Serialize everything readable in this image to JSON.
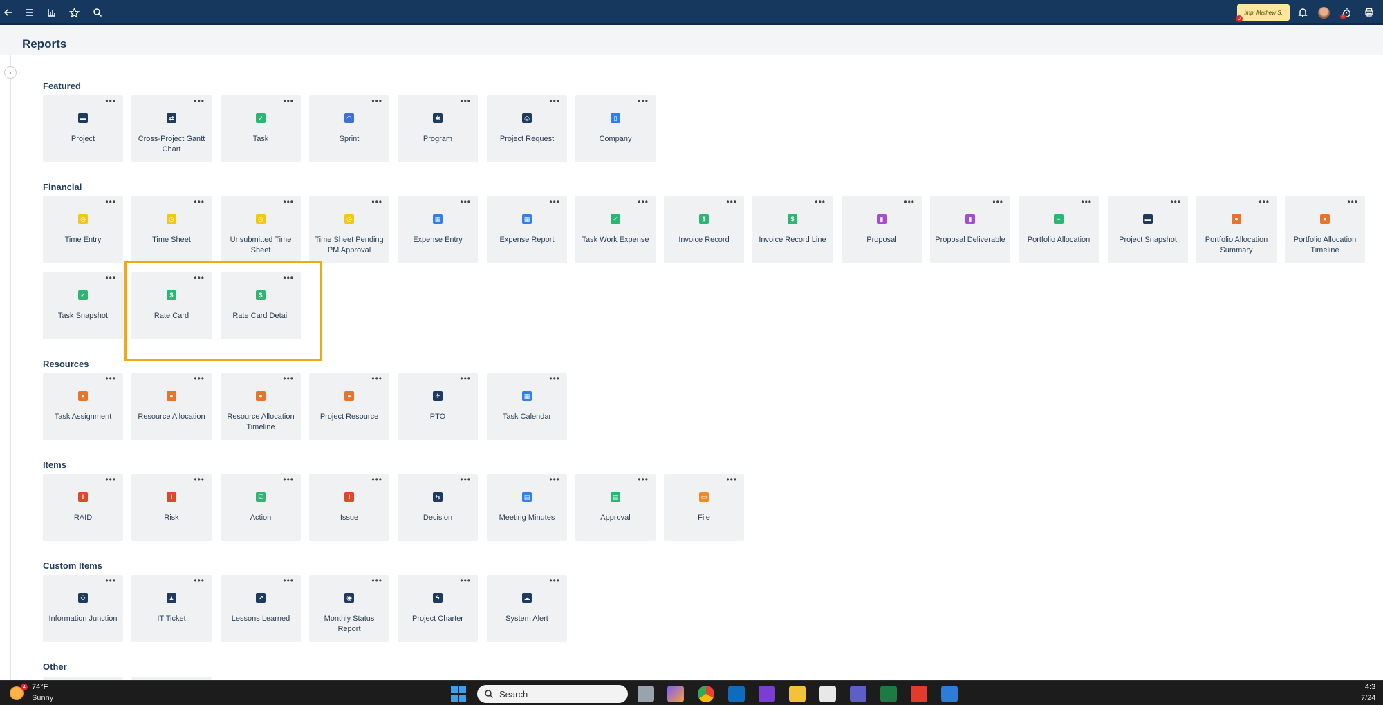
{
  "topbar": {
    "impersonation": "Imp: Mathew S.",
    "impersonation_count": "0",
    "timer_badge": "0"
  },
  "page": {
    "title": "Reports"
  },
  "sections": {
    "featured": {
      "label": "Featured",
      "tiles": [
        {
          "label": "Project",
          "icon": "briefcase-icon",
          "color": "#1e3a5c"
        },
        {
          "label": "Cross-Project Gantt Chart",
          "icon": "swap-arrows-icon",
          "color": "#1e3a5c"
        },
        {
          "label": "Task",
          "icon": "check-square-icon",
          "color": "#2bb673"
        },
        {
          "label": "Sprint",
          "icon": "sprint-icon",
          "color": "#3e6fd8"
        },
        {
          "label": "Program",
          "icon": "gear-icon",
          "color": "#1e3a5c"
        },
        {
          "label": "Project Request",
          "icon": "target-icon",
          "color": "#1e3a5c"
        },
        {
          "label": "Company",
          "icon": "building-icon",
          "color": "#2f80ed"
        }
      ]
    },
    "financial": {
      "label": "Financial",
      "tiles": [
        {
          "label": "Time Entry",
          "icon": "clock-icon",
          "color": "#f5c518"
        },
        {
          "label": "Time Sheet",
          "icon": "clock-icon",
          "color": "#f5c518"
        },
        {
          "label": "Unsubmitted Time Sheet",
          "icon": "clock-icon",
          "color": "#f5c518"
        },
        {
          "label": "Time Sheet Pending PM Approval",
          "icon": "clock-icon",
          "color": "#f5c518"
        },
        {
          "label": "Expense Entry",
          "icon": "expense-grid-icon",
          "color": "#2f80ed"
        },
        {
          "label": "Expense Report",
          "icon": "expense-grid-icon",
          "color": "#2f80ed"
        },
        {
          "label": "Task Work Expense",
          "icon": "check-square-icon",
          "color": "#2bb673"
        },
        {
          "label": "Invoice Record",
          "icon": "dollar-icon",
          "color": "#2bb673"
        },
        {
          "label": "Invoice Record Line",
          "icon": "dollar-icon",
          "color": "#2bb673"
        },
        {
          "label": "Proposal",
          "icon": "book-icon",
          "color": "#a64bd6"
        },
        {
          "label": "Proposal Deliverable",
          "icon": "book-icon",
          "color": "#a64bd6"
        },
        {
          "label": "Portfolio Allocation",
          "icon": "money-stack-icon",
          "color": "#2bb673"
        },
        {
          "label": "Project Snapshot",
          "icon": "briefcase-icon",
          "color": "#1e3a5c"
        },
        {
          "label": "Portfolio Allocation Summary",
          "icon": "people-icon",
          "color": "#e8742b"
        },
        {
          "label": "Portfolio Allocation Timeline",
          "icon": "people-icon",
          "color": "#e8742b"
        },
        {
          "label": "Task Snapshot",
          "icon": "check-square-icon",
          "color": "#2bb673"
        },
        {
          "label": "Rate Card",
          "icon": "dollar-icon",
          "color": "#2bb673"
        },
        {
          "label": "Rate Card Detail",
          "icon": "dollar-icon",
          "color": "#2bb673"
        }
      ]
    },
    "resources": {
      "label": "Resources",
      "tiles": [
        {
          "label": "Task Assignment",
          "icon": "people-icon",
          "color": "#e8742b"
        },
        {
          "label": "Resource Allocation",
          "icon": "people-icon",
          "color": "#e8742b"
        },
        {
          "label": "Resource Allocation Timeline",
          "icon": "people-icon",
          "color": "#e8742b"
        },
        {
          "label": "Project Resource",
          "icon": "people-icon",
          "color": "#e8742b"
        },
        {
          "label": "PTO",
          "icon": "airplane-icon",
          "color": "#1e3a5c"
        },
        {
          "label": "Task Calendar",
          "icon": "calendar-icon",
          "color": "#2f80ed"
        }
      ]
    },
    "items": {
      "label": "Items",
      "tiles": [
        {
          "label": "RAID",
          "icon": "warning-icon",
          "color": "#e0462b"
        },
        {
          "label": "Risk",
          "icon": "warning-icon",
          "color": "#e0462b"
        },
        {
          "label": "Action",
          "icon": "checklist-icon",
          "color": "#2bb673"
        },
        {
          "label": "Issue",
          "icon": "exclamation-icon",
          "color": "#e0462b"
        },
        {
          "label": "Decision",
          "icon": "decision-icon",
          "color": "#1e3a5c"
        },
        {
          "label": "Meeting Minutes",
          "icon": "document-clock-icon",
          "color": "#2f80ed"
        },
        {
          "label": "Approval",
          "icon": "document-check-icon",
          "color": "#2bb673"
        },
        {
          "label": "File",
          "icon": "file-icon",
          "color": "#f08a24"
        }
      ]
    },
    "custom_items": {
      "label": "Custom Items",
      "tiles": [
        {
          "label": "Information Junction",
          "icon": "grid-dots-icon",
          "color": "#1e3a5c"
        },
        {
          "label": "IT Ticket",
          "icon": "ticket-icon",
          "color": "#1e3a5c"
        },
        {
          "label": "Lessons Learned",
          "icon": "trend-icon",
          "color": "#1e3a5c"
        },
        {
          "label": "Monthly Status Report",
          "icon": "report-icon",
          "color": "#1e3a5c"
        },
        {
          "label": "Project Charter",
          "icon": "bolt-icon",
          "color": "#1e3a5c"
        },
        {
          "label": "System Alert",
          "icon": "cloud-icon",
          "color": "#1e3a5c"
        }
      ]
    },
    "other": {
      "label": "Other"
    }
  },
  "taskbar": {
    "weather_temp": "74°F",
    "weather_desc": "Sunny",
    "weather_badge": "4",
    "search_label": "Search",
    "time": "4:3",
    "date": "7/24"
  }
}
